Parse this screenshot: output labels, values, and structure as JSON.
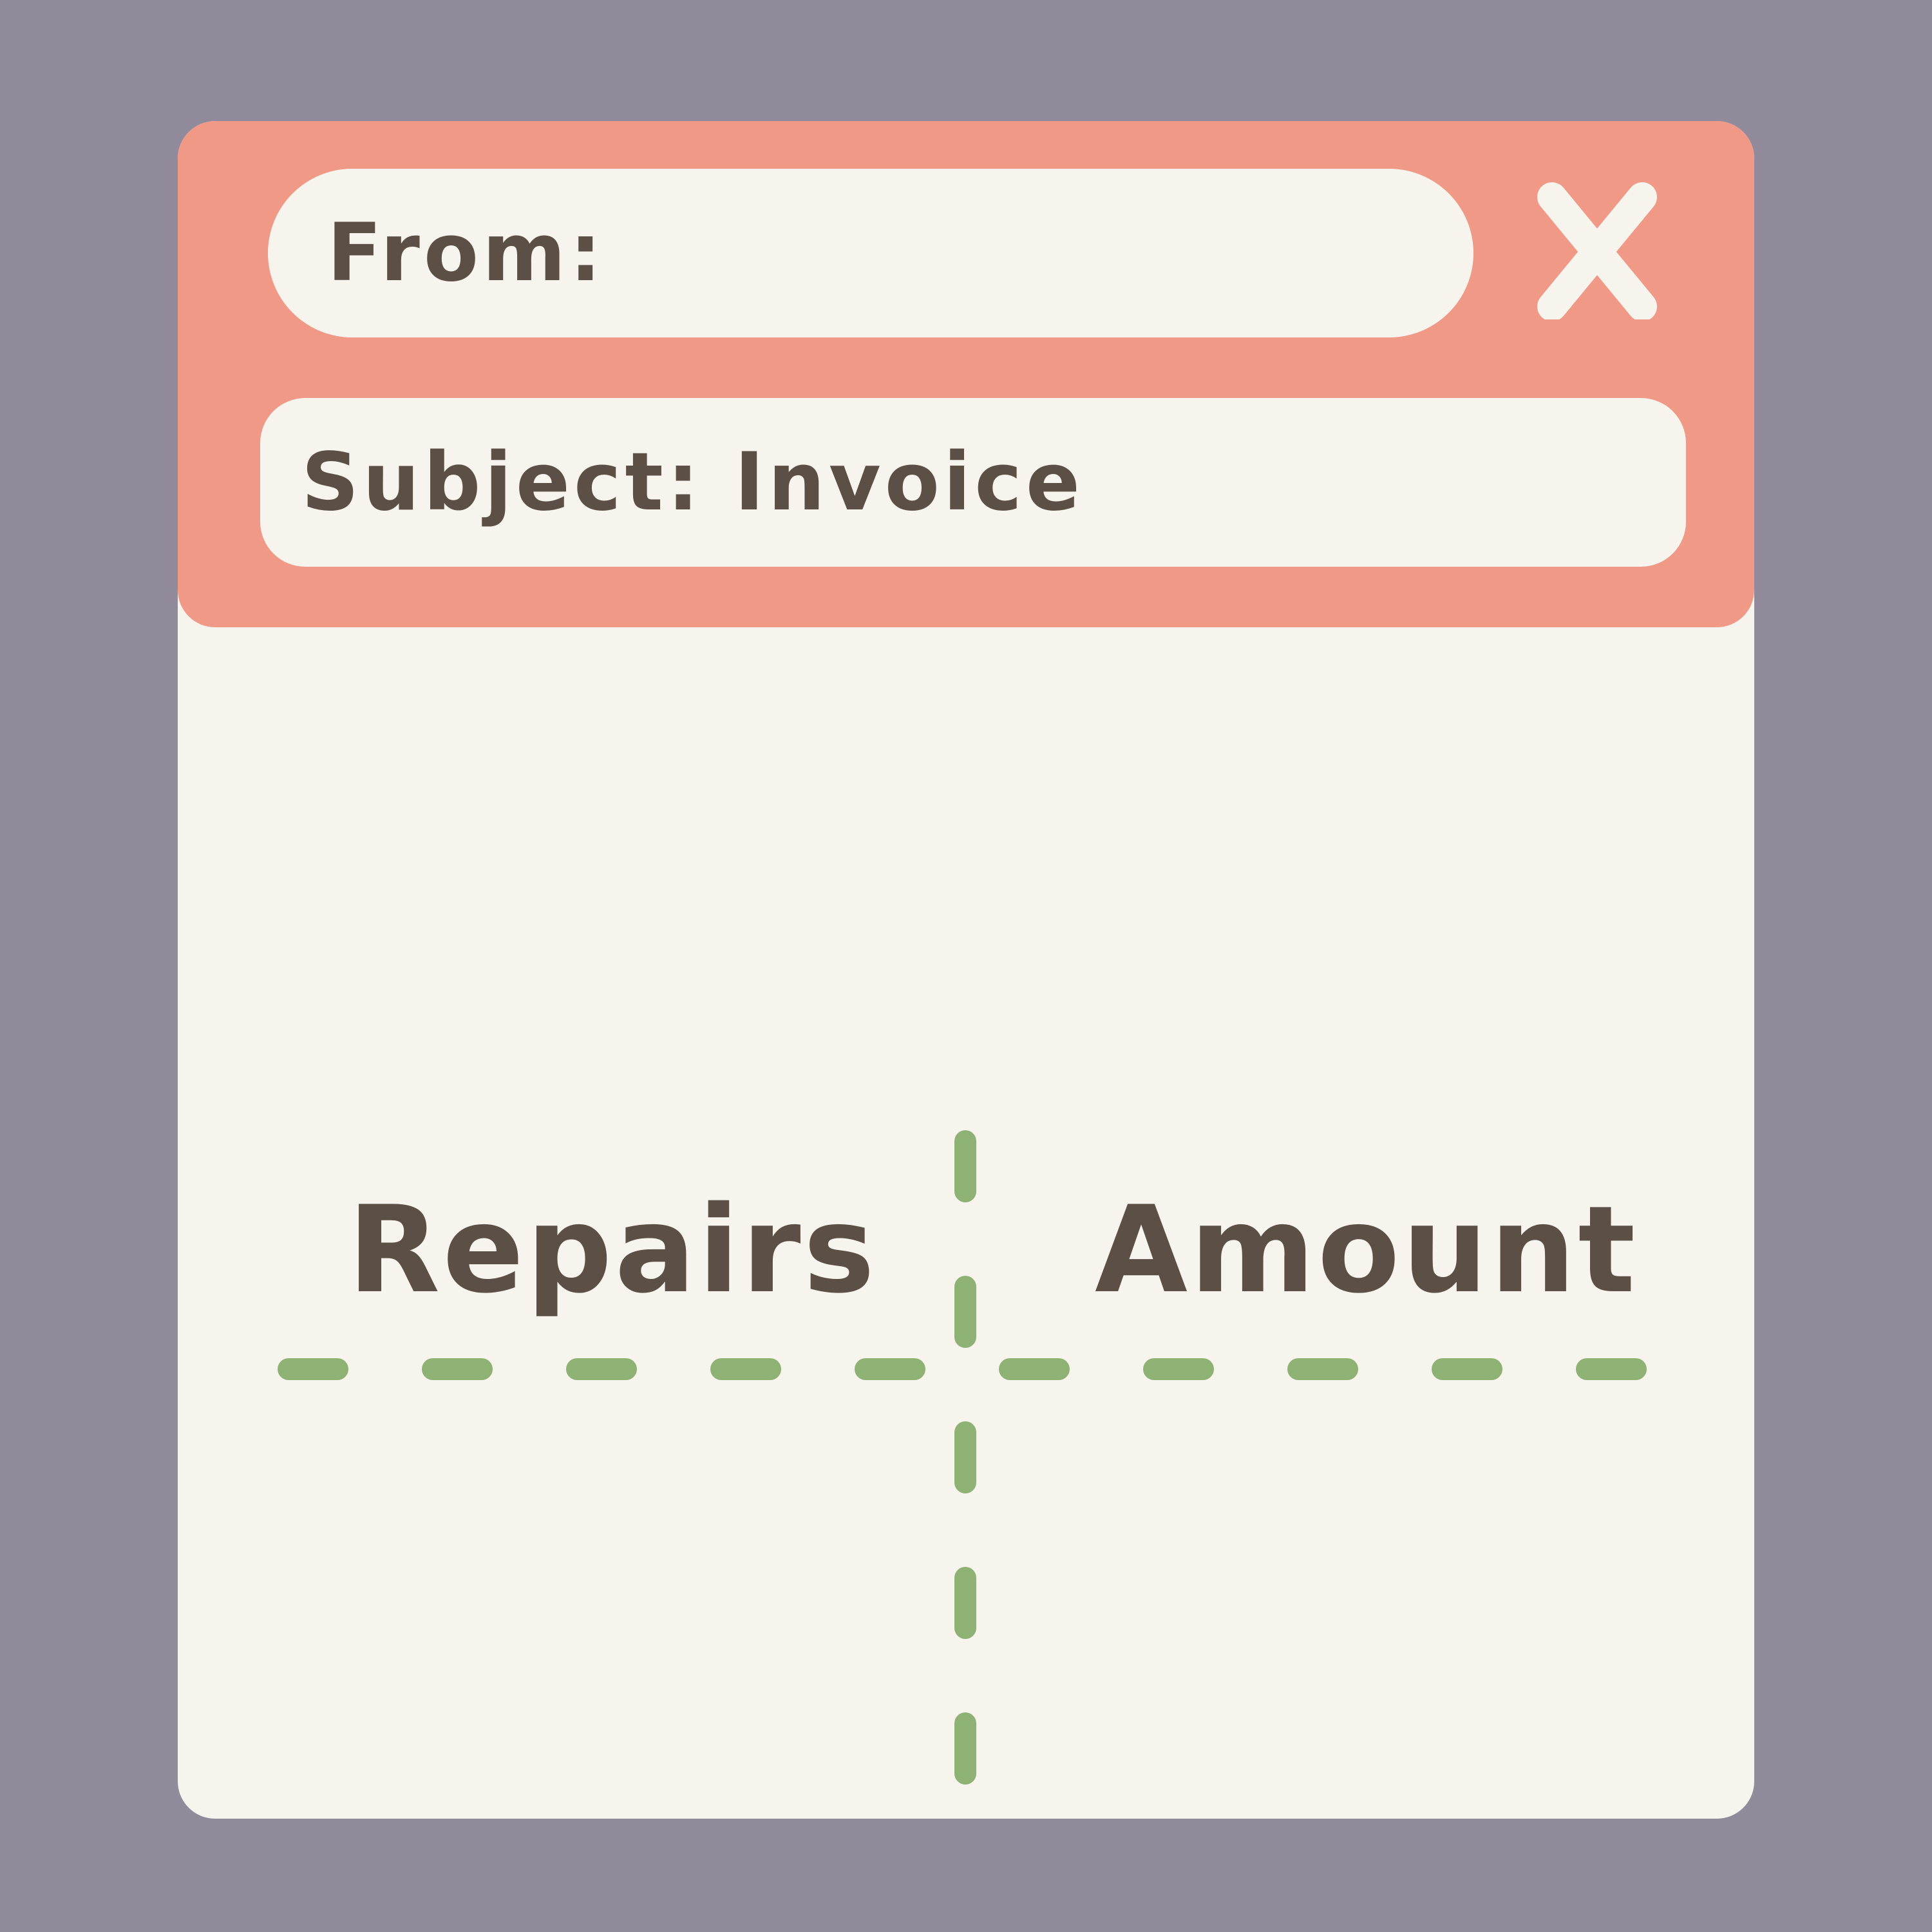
{
  "email": {
    "from_label": "From:",
    "subject_label": "Subject: Invoice",
    "close_glyph": "X"
  },
  "table": {
    "headers": [
      "Repairs",
      "Amount"
    ],
    "grid_color": "#8db274"
  },
  "colors": {
    "background": "#908a9a",
    "header": "#ef9986",
    "panel": "#f7f3ed",
    "text": "#5c4f46"
  },
  "icons": {
    "close": "close-icon"
  }
}
